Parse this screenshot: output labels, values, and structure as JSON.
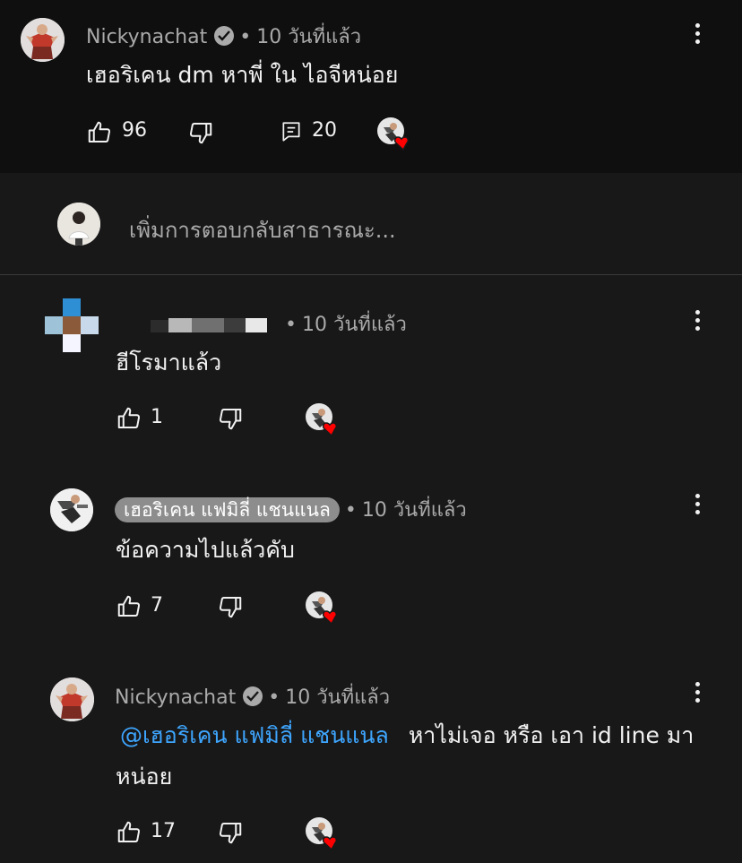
{
  "top_comment": {
    "author": "Nickynachat",
    "time": "10 วันที่แล้ว",
    "text": "เฮอริเคน dm หาพี่ ใน ไอจีหน่อย",
    "likes": "96",
    "replies": "20"
  },
  "reply_box": {
    "placeholder": "เพิ่มการตอบกลับสาธารณะ..."
  },
  "replies": [
    {
      "author": "",
      "time": "10 วันที่แล้ว",
      "text": "ฮีโรมาแล้ว",
      "likes": "1"
    },
    {
      "author": "เฮอริเคน แฟมิลี่ แชนแนล",
      "time": "10 วันที่แล้ว",
      "text": "ข้อความไปแล้วคับ",
      "likes": "7"
    },
    {
      "author": "Nickynachat",
      "time": "10 วันที่แล้ว",
      "mention": "@เฮอริเคน แฟมิลี่ แชนแนล",
      "text_line1": "หาไม่เจอ หรือ เอา id line มา",
      "text_line2": "หน่อย",
      "likes": "17"
    }
  ],
  "icons": {
    "like": "thumbs-up-icon",
    "dislike": "thumbs-down-icon",
    "reply": "comment-icon",
    "heart": "creator-heart-icon",
    "more": "more-vert-icon",
    "verified": "verified-check-icon"
  },
  "colors": {
    "mention": "#3ea6ff",
    "heart": "#ff0000",
    "background": "#181818",
    "top_background": "#0f0f0f"
  }
}
